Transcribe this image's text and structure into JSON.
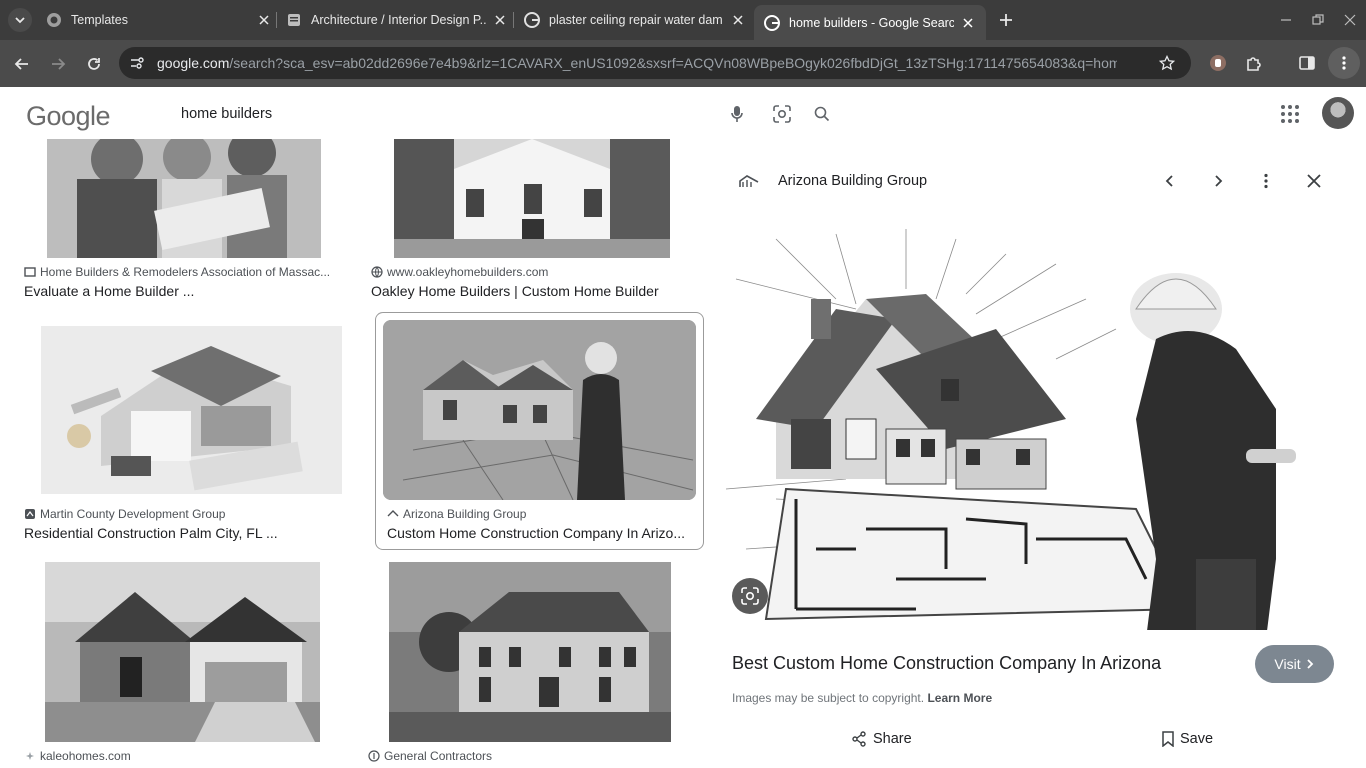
{
  "browser": {
    "tabs": [
      {
        "title": "Templates",
        "icon": "templates-favicon"
      },
      {
        "title": "Architecture / Interior Design P...",
        "icon": "doc-favicon"
      },
      {
        "title": "plaster ceiling repair water dam",
        "icon": "google-favicon"
      },
      {
        "title": "home builders - Google Search",
        "icon": "google-favicon",
        "active": true
      }
    ],
    "url_host": "google.com",
    "url_path": "/search?sca_esv=ab02dd2696e7e4b9&rlz=1CAVARX_enUS1092&sxsrf=ACQVn08WBpeBOgyk026fbdDjGt_13zTSHg:1711475654083&q=home+bu..."
  },
  "search": {
    "logo_text": "Google",
    "query": "home builders"
  },
  "results": [
    {
      "source": "Home Builders & Remodelers Association of Massac...",
      "caption": "Evaluate a Home Builder ..."
    },
    {
      "source": "www.oakleyhomebuilders.com",
      "caption": "Oakley Home Builders | Custom Home Builder"
    },
    {
      "source": "Martin County Development Group",
      "caption": "Residential Construction Palm City, FL ..."
    },
    {
      "source": "Arizona Building Group",
      "caption": "Custom Home Construction Company In Arizo...",
      "selected": true
    },
    {
      "source": "kaleohomes.com",
      "caption": ""
    },
    {
      "source": "General Contractors",
      "caption": ""
    }
  ],
  "panel": {
    "site": "Arizona Building Group",
    "title": "Best Custom Home Construction Company In Arizona",
    "visit_label": "Visit",
    "copyright_text": "Images may be subject to copyright.",
    "learn_more": "Learn More",
    "share_label": "Share",
    "save_label": "Save"
  }
}
